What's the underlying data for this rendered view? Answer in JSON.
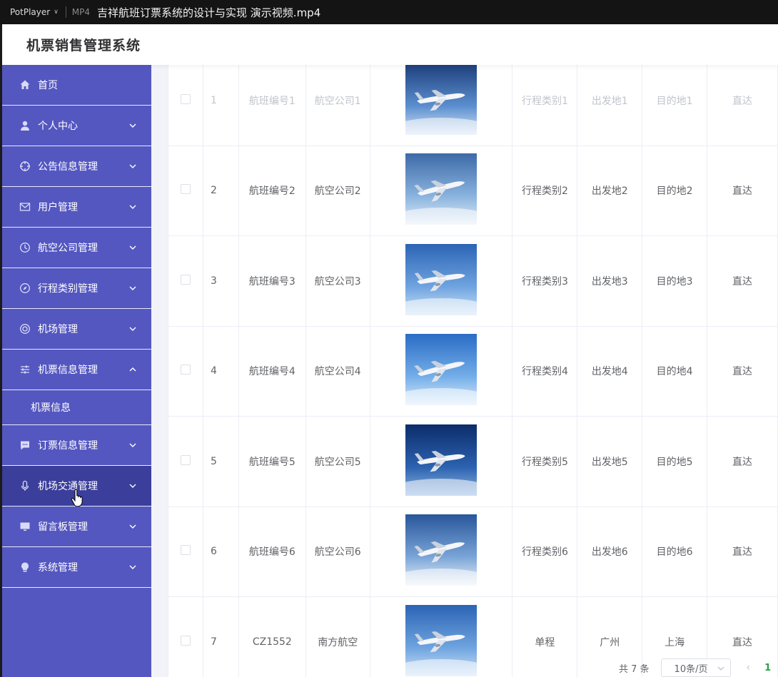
{
  "titlebar": {
    "app_name": "PotPlayer",
    "format": "MP4",
    "file_title": "吉祥航班订票系统的设计与实现 演示视频.mp4"
  },
  "header": {
    "title": "机票销售管理系统"
  },
  "sidebar": {
    "items": [
      {
        "label": "首页",
        "icon": "home-icon",
        "has_arrow": false
      },
      {
        "label": "个人中心",
        "icon": "user-icon",
        "has_arrow": true
      },
      {
        "label": "公告信息管理",
        "icon": "crosshair-icon",
        "has_arrow": true
      },
      {
        "label": "用户管理",
        "icon": "mail-icon",
        "has_arrow": true
      },
      {
        "label": "航空公司管理",
        "icon": "clock-icon",
        "has_arrow": true
      },
      {
        "label": "行程类别管理",
        "icon": "compass-icon",
        "has_arrow": true
      },
      {
        "label": "机场管理",
        "icon": "target-icon",
        "has_arrow": true
      },
      {
        "label": "机票信息管理",
        "icon": "sliders-icon",
        "has_arrow": true,
        "expanded": true
      },
      {
        "label": "订票信息管理",
        "icon": "chat-icon",
        "has_arrow": true
      },
      {
        "label": "机场交通管理",
        "icon": "microphone-icon",
        "has_arrow": true,
        "hovered": true
      },
      {
        "label": "留言板管理",
        "icon": "monitor-icon",
        "has_arrow": true
      },
      {
        "label": "系统管理",
        "icon": "bulb-icon",
        "has_arrow": true
      }
    ],
    "sub_item": "机票信息"
  },
  "table": {
    "partial_top_row": {
      "index": "1",
      "flight_no": "航班编号1",
      "airline": "航空公司1",
      "type": "行程类别1",
      "departure": "出发地1",
      "destination": "目的地1",
      "route": "直达"
    },
    "rows": [
      {
        "index": "2",
        "flight_no": "航班编号2",
        "airline": "航空公司2",
        "type": "行程类别2",
        "departure": "出发地2",
        "destination": "目的地2",
        "route": "直达"
      },
      {
        "index": "3",
        "flight_no": "航班编号3",
        "airline": "航空公司3",
        "type": "行程类别3",
        "departure": "出发地3",
        "destination": "目的地3",
        "route": "直达"
      },
      {
        "index": "4",
        "flight_no": "航班编号4",
        "airline": "航空公司4",
        "type": "行程类别4",
        "departure": "出发地4",
        "destination": "目的地4",
        "route": "直达"
      },
      {
        "index": "5",
        "flight_no": "航班编号5",
        "airline": "航空公司5",
        "type": "行程类别5",
        "departure": "出发地5",
        "destination": "目的地5",
        "route": "直达"
      },
      {
        "index": "6",
        "flight_no": "航班编号6",
        "airline": "航空公司6",
        "type": "行程类别6",
        "departure": "出发地6",
        "destination": "目的地6",
        "route": "直达"
      },
      {
        "index": "7",
        "flight_no": "CZ1552",
        "airline": "南方航空",
        "type": "单程",
        "departure": "广州",
        "destination": "上海",
        "route": "直达"
      }
    ]
  },
  "pagination": {
    "total": "共 7 条",
    "page_size": "10条/页",
    "current_page": "1"
  },
  "colors": {
    "sidebar_bg": "#5457c0",
    "sidebar_active": "#3b3e9a",
    "pager_active": "#29a04a"
  }
}
